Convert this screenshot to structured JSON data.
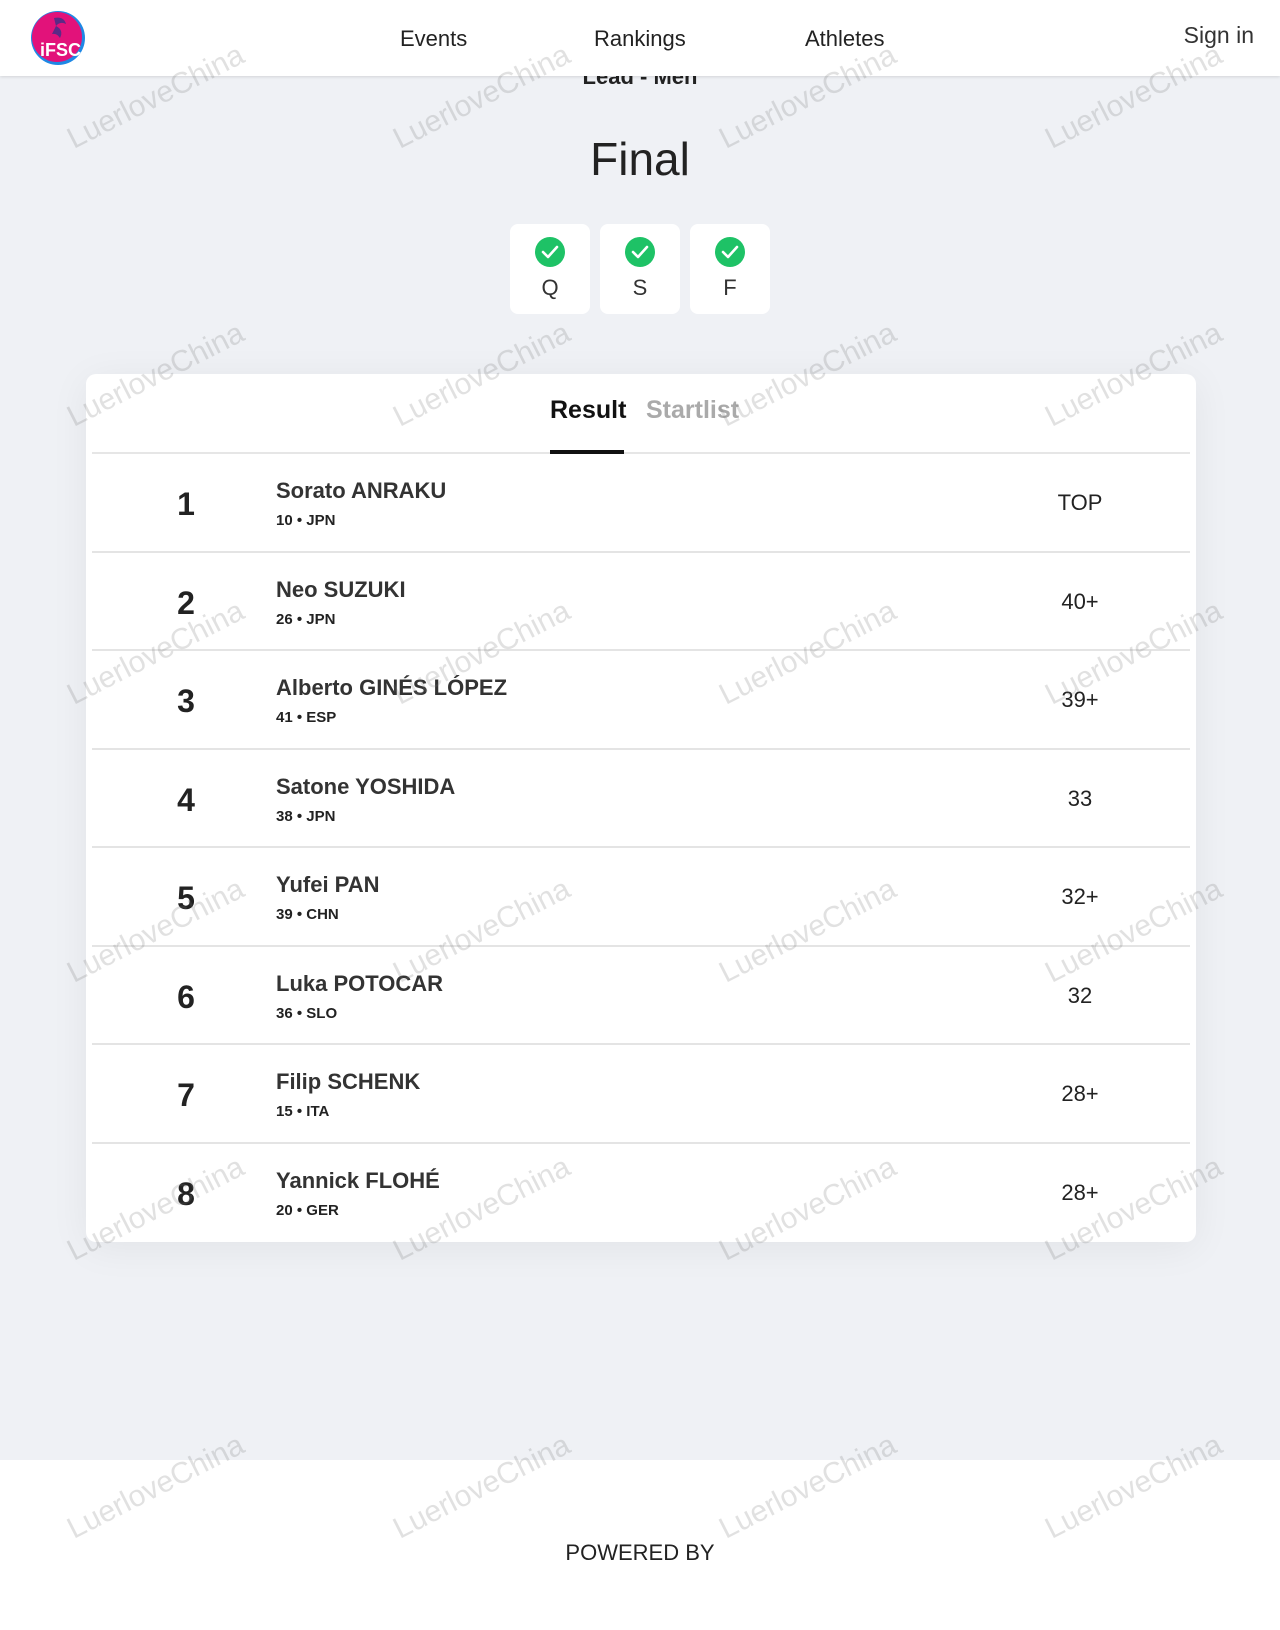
{
  "header": {
    "logo_text": "IFSC",
    "nav": [
      "Events",
      "Rankings",
      "Athletes"
    ],
    "signin_label": "Sign in"
  },
  "event": {
    "discipline": "Lead - Men",
    "round": "Final"
  },
  "phases": [
    {
      "label": "Q",
      "status": "complete"
    },
    {
      "label": "S",
      "status": "complete"
    },
    {
      "label": "F",
      "status": "complete"
    }
  ],
  "tabs": {
    "result": "Result",
    "startlist": "Startlist"
  },
  "results": [
    {
      "rank": "1",
      "name": "Sorato ANRAKU",
      "meta": "10 • JPN",
      "score": "TOP"
    },
    {
      "rank": "2",
      "name": "Neo SUZUKI",
      "meta": "26 • JPN",
      "score": "40+"
    },
    {
      "rank": "3",
      "name": "Alberto GINÉS LÓPEZ",
      "meta": "41 • ESP",
      "score": "39+"
    },
    {
      "rank": "4",
      "name": "Satone YOSHIDA",
      "meta": "38 • JPN",
      "score": "33"
    },
    {
      "rank": "5",
      "name": "Yufei PAN",
      "meta": "39 • CHN",
      "score": "32+"
    },
    {
      "rank": "6",
      "name": "Luka POTOCAR",
      "meta": "36 • SLO",
      "score": "32"
    },
    {
      "rank": "7",
      "name": "Filip SCHENK",
      "meta": "15 • ITA",
      "score": "28+"
    },
    {
      "rank": "8",
      "name": "Yannick FLOHÉ",
      "meta": "20 • GER",
      "score": "28+"
    }
  ],
  "footer": {
    "powered_by": "POWERED BY"
  },
  "watermark": "LuerloveChina",
  "colors": {
    "background": "#eff1f5",
    "check": "#1ec266",
    "logo": "#e2127a"
  }
}
